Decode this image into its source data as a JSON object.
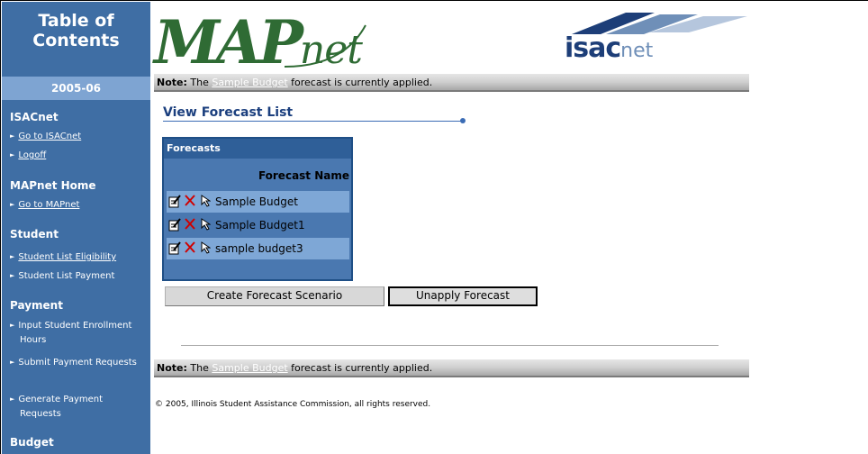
{
  "sidebar": {
    "title_line1": "Table of",
    "title_line2": "Contents",
    "year": "2005-06",
    "sections": {
      "isacnet": {
        "heading": "ISACnet",
        "links": [
          "Go to ISACnet",
          "Logoff"
        ]
      },
      "mapnet_home": {
        "heading": "MAPnet Home",
        "links": [
          "Go to MAPnet"
        ]
      },
      "student": {
        "heading": "Student",
        "links": [
          "Student List Eligibility",
          "Student List Payment"
        ]
      },
      "payment": {
        "heading": "Payment",
        "links": [
          "Input Student Enrollment Hours",
          "Submit Payment Requests",
          "Generate Payment Requests"
        ]
      },
      "budget": {
        "heading": "Budget"
      }
    }
  },
  "header": {
    "logo_map_big": "MAP",
    "logo_map_small": "net",
    "logo_isac_bold": "isac",
    "logo_isac_light": "net"
  },
  "note": {
    "label": "Note:",
    "prefix": " The ",
    "budget_link": "Sample Budget",
    "suffix": " forecast is currently applied."
  },
  "main": {
    "page_title": "View Forecast List",
    "panel_title": "Forecasts",
    "column_header": "Forecast Name",
    "forecasts": [
      {
        "name": "Sample Budget",
        "edit_icon": "edit-notepad-icon",
        "delete_icon": "delete-x-icon",
        "apply_icon": "apply-pointer-icon"
      },
      {
        "name": "Sample Budget1",
        "edit_icon": "edit-notepad-icon",
        "delete_icon": "delete-x-icon",
        "apply_icon": "apply-pointer-icon"
      },
      {
        "name": "sample budget3",
        "edit_icon": "edit-notepad-icon",
        "delete_icon": "delete-x-icon",
        "apply_icon": "apply-pointer-icon"
      }
    ],
    "create_button": "Create Forecast Scenario",
    "unapply_button": "Unapply Forecast"
  },
  "footer": {
    "copyright": "© 2005, Illinois Student Assistance Commission, all rights reserved."
  },
  "colors": {
    "sidebar_bg": "#3f6ea4",
    "year_bg": "#7ea4d2",
    "accent": "#1b3f7e",
    "logo_green": "#2f6b34",
    "panel_bg": "#4a78b0",
    "row_shade": "#7ea7d6"
  }
}
